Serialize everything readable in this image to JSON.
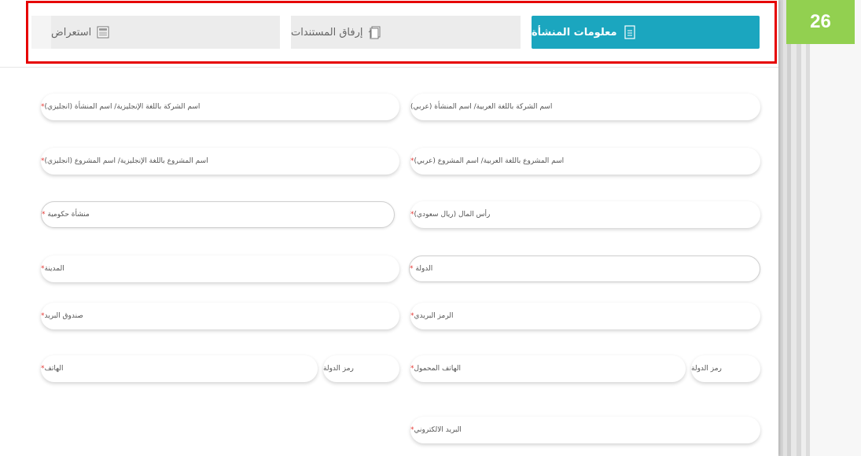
{
  "page_number": "26",
  "colors": {
    "active_tab": "#1ba6bf",
    "inactive_tab": "#ececec",
    "highlight": "#e60000",
    "badge": "#92d050",
    "required": "#e53935"
  },
  "tabs": [
    {
      "label": "معلومات المنشأة",
      "icon": "document-icon",
      "active": true
    },
    {
      "label": "إرفاق المستندات",
      "icon": "attachment-icon",
      "active": false
    },
    {
      "label": "استعراض",
      "icon": "review-icon",
      "active": false
    }
  ],
  "form": {
    "company_name_ar": {
      "label": "اسم الشركة باللغة العربية/ اسم المنشأة (عربي)",
      "required": ""
    },
    "company_name_en": {
      "label": "اسم الشركة باللغة الإنجليزية/ اسم المنشأة (انجليزي)",
      "required": "*"
    },
    "project_name_ar": {
      "label": "اسم المشروع باللغة العربية/ اسم المشروع (عربي)",
      "required": "*"
    },
    "project_name_en": {
      "label": "اسم المشروع باللغة الإنجليزية/ اسم المشروع (انجليزي)",
      "required": "*"
    },
    "capital": {
      "label": "رأس المال (ريال سعودي)",
      "required": "*"
    },
    "government_entity": {
      "label": "منشأة حكومية",
      "required": "*"
    },
    "country": {
      "label": "الدولة",
      "required": "*"
    },
    "city": {
      "label": "المدينة",
      "required": "*"
    },
    "postal_code": {
      "label": "الرمز البريدي",
      "required": "*"
    },
    "po_box": {
      "label": "صندوق البريد",
      "required": "*"
    },
    "mobile_country_code": {
      "label": "رمز الدولة"
    },
    "mobile": {
      "label": "الهاتف المحمول",
      "required": "*"
    },
    "phone_country_code": {
      "label": "رمز الدولة"
    },
    "phone": {
      "label": "الهاتف",
      "required": "*"
    },
    "email": {
      "label": "البريد الالكتروني",
      "required": "*"
    }
  }
}
